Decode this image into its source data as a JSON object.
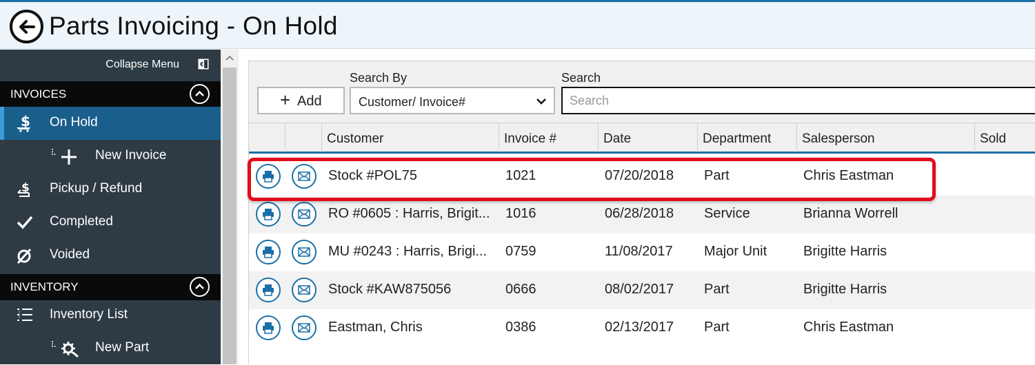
{
  "header": {
    "title": "Parts Invoicing - On Hold"
  },
  "sidebar": {
    "collapse_label": "Collapse Menu",
    "sections": [
      {
        "label": "INVOICES"
      },
      {
        "label": "INVENTORY"
      }
    ],
    "items": [
      {
        "label": "On Hold",
        "icon": "dollar-cart-icon",
        "active": true
      },
      {
        "label": "New Invoice",
        "icon": "add-sub-icon"
      },
      {
        "label": "Pickup / Refund",
        "icon": "refund-icon"
      },
      {
        "label": "Completed",
        "icon": "checkmark-icon"
      },
      {
        "label": "Voided",
        "icon": "void-icon"
      },
      {
        "label": "Inventory List",
        "icon": "list-icon"
      },
      {
        "label": "New Part",
        "icon": "gear-sub-icon"
      }
    ]
  },
  "toolbar": {
    "add_label": "Add",
    "search_by_label": "Search By",
    "search_by_value": "Customer/ Invoice#",
    "search_label": "Search",
    "search_placeholder": "Search"
  },
  "grid": {
    "columns": [
      "Customer",
      "Invoice #",
      "Date",
      "Department",
      "Salesperson",
      "Sold"
    ],
    "rows": [
      {
        "customer": "Stock #POL75",
        "invoice": "1021",
        "date": "07/20/2018",
        "department": "Part",
        "salesperson": "Chris Eastman"
      },
      {
        "customer": "RO #0605 : Harris, Brigit...",
        "invoice": "1016",
        "date": "06/28/2018",
        "department": "Service",
        "salesperson": "Brianna Worrell"
      },
      {
        "customer": "MU #0243 : Harris, Brigi...",
        "invoice": "0759",
        "date": "11/08/2017",
        "department": "Major Unit",
        "salesperson": "Brigitte Harris"
      },
      {
        "customer": "Stock #KAW875056",
        "invoice": "0666",
        "date": "08/02/2017",
        "department": "Part",
        "salesperson": "Brigitte Harris"
      },
      {
        "customer": "Eastman, Chris",
        "invoice": "0386",
        "date": "02/13/2017",
        "department": "Part",
        "salesperson": "Chris Eastman"
      }
    ]
  },
  "colors": {
    "accent": "#1a6da3",
    "sidebar_bg": "#2e3b45",
    "active_bg": "#1a5e8c",
    "highlight": "#e30b1c"
  }
}
